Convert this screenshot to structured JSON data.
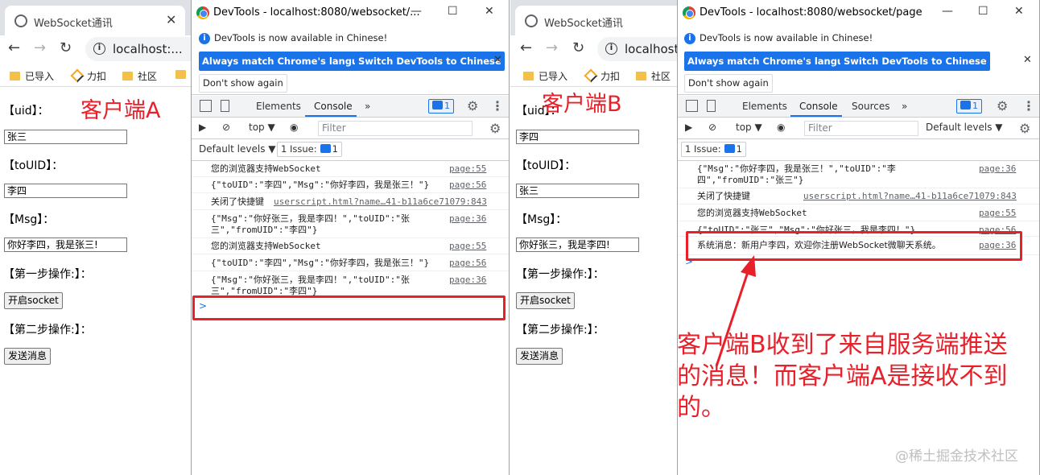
{
  "windows": [
    {
      "tab_title": "WebSocket通讯",
      "omnibox_text": "localhost:...",
      "bookmarks": [
        "已导入",
        "力扣",
        "社区"
      ],
      "client_label": "客户端A",
      "form": {
        "uid_label": "【uid】：",
        "uid_value": "张三",
        "touid_label": "【toUID】：",
        "touid_value": "李四",
        "msg_label": "【Msg】：",
        "msg_value": "你好李四，我是张三!",
        "step1_label": "【第一步操作:】：",
        "open_button": "开启socket",
        "step2_label": "【第二步操作:】：",
        "send_button": "发送消息"
      }
    },
    {
      "tab_title": "WebSocket通讯",
      "omnibox_text": "localhost:",
      "bookmarks": [
        "已导入",
        "力扣",
        "社区"
      ],
      "client_label": "客户端B",
      "form": {
        "uid_label": "【uid】：",
        "uid_value": "李四",
        "touid_label": "【toUID】：",
        "touid_value": "张三",
        "msg_label": "【Msg】：",
        "msg_value": "你好张三，我是李四!",
        "step1_label": "【第一步操作:】：",
        "open_button": "开启socket",
        "step2_label": "【第二步操作:】：",
        "send_button": "发送消息"
      }
    }
  ],
  "devtools": [
    {
      "title": "DevTools - localhost:8080/websocket/...",
      "info_text": "DevTools is now available in Chinese!",
      "btn_match": "Always match Chrome's language",
      "btn_switch": "Switch DevTools to Chinese",
      "btn_dont": "Don't show again",
      "tabs": [
        "Elements",
        "Console"
      ],
      "more_tabs": "»",
      "badge": "1",
      "context": "top ▼",
      "filter_placeholder": "Filter",
      "levels": "Default levels ▼",
      "issue_text": "1 Issue:",
      "issue_count": "1",
      "messages": [
        {
          "text": "您的浏览器支持WebSocket",
          "src": "page:55"
        },
        {
          "text": "{\"toUID\":\"李四\",\"Msg\":\"你好李四，我是张三！\"}",
          "src": "page:56"
        },
        {
          "text": "关闭了快捷键",
          "src": "userscript.html?name…41-b11a6ce71079:843"
        },
        {
          "text": "{\"Msg\":\"你好张三，我是李四！\",\"toUID\":\"张\n三\",\"fromUID\":\"李四\"}",
          "src": "page:36"
        },
        {
          "text": "您的浏览器支持WebSocket",
          "src": "page:55"
        },
        {
          "text": "{\"toUID\":\"李四\",\"Msg\":\"你好李四，我是张三！\"}",
          "src": "page:56"
        },
        {
          "text": "{\"Msg\":\"你好张三，我是李四！\",\"toUID\":\"张\n三\",\"fromUID\":\"李四\"}",
          "src": "page:36"
        }
      ],
      "prompt": ">"
    },
    {
      "title": "DevTools - localhost:8080/websocket/page",
      "info_text": "DevTools is now available in Chinese!",
      "btn_match": "Always match Chrome's language",
      "btn_switch": "Switch DevTools to Chinese",
      "btn_dont": "Don't show again",
      "tabs": [
        "Elements",
        "Console",
        "Sources"
      ],
      "more_tabs": "»",
      "badge": "1",
      "context": "top ▼",
      "filter_placeholder": "Filter",
      "levels": "Default levels ▼",
      "issue_text": "1 Issue:",
      "issue_count": "1",
      "messages": [
        {
          "text": "{\"Msg\":\"你好李四，我是张三！\",\"toUID\":\"李\n四\",\"fromUID\":\"张三\"}",
          "src": "page:36"
        },
        {
          "text": "关闭了快捷键",
          "src": "userscript.html?name…41-b11a6ce71079:843"
        },
        {
          "text": "您的浏览器支持WebSocket",
          "src": "page:55"
        },
        {
          "text": "{\"toUID\":\"张三\",\"Msg\":\"你好张三，我是李四！\"}",
          "src": "page:56"
        },
        {
          "text": "系统消息：新用户李四，欢迎你注册WebSocket微聊天系统。",
          "src": "page:36"
        }
      ],
      "prompt": ">"
    }
  ],
  "annotation": {
    "lines": [
      "客户端B收到了来自服务端推送",
      "的消息！而客户端A是接收不到",
      "的。"
    ],
    "color": "#e8202a"
  },
  "watermark": "@稀土掘金技术社区"
}
